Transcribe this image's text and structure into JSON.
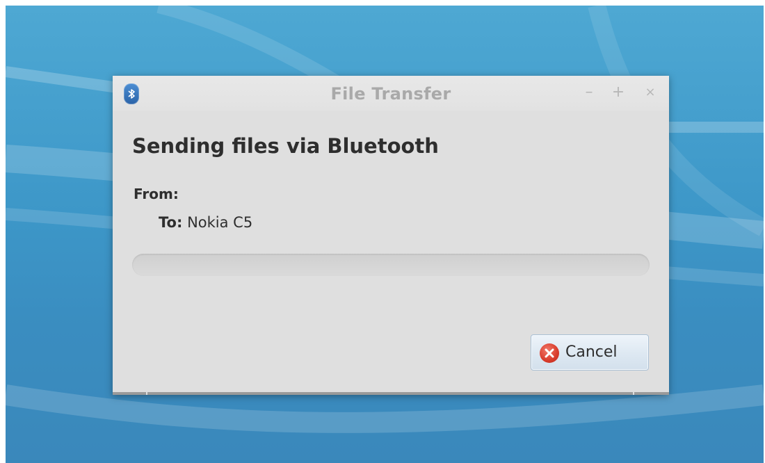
{
  "window": {
    "title": "File Transfer",
    "min_symbol": "–",
    "max_symbol": "+",
    "close_symbol": "×"
  },
  "dialog": {
    "heading": "Sending files via Bluetooth",
    "from_label": "From:",
    "from_value": "",
    "to_label": "To:",
    "to_value": "Nokia C5",
    "progress": 0,
    "cancel_label": "Cancel"
  },
  "icons": {
    "app": "bluetooth-icon",
    "cancel": "cancel-icon"
  },
  "colors": {
    "desktop": "#4ea8d3",
    "window_bg": "#dfdfdf",
    "title_text": "#a9a9a9",
    "cancel_icon": "#d83b2b"
  }
}
